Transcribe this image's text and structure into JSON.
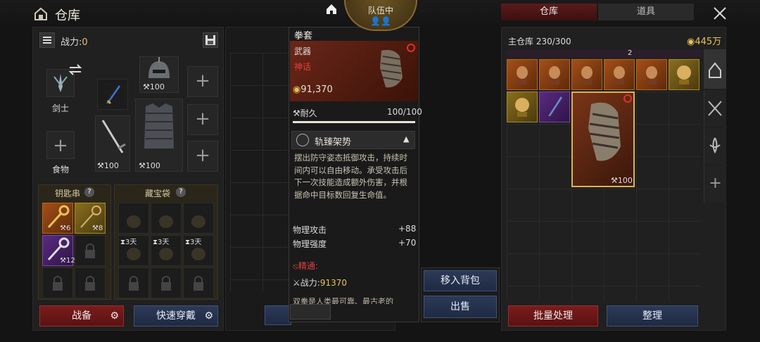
{
  "header": {
    "title": "仓库",
    "home_icon": "home-icon",
    "close_icon": "close-icon"
  },
  "left": {
    "combat_label": "战力:",
    "combat_value": "0",
    "class_label": "剑士",
    "food_label": "食物",
    "helmet_durability": "100",
    "weapon_durability": "100",
    "armor_durability": "100",
    "keyring": {
      "title": "钥匙串",
      "help": "?",
      "counts": [
        "6",
        "8",
        "12"
      ]
    },
    "treasure": {
      "title": "藏宝袋",
      "help": "?",
      "days": [
        "3天",
        "3天",
        "3天"
      ]
    },
    "btn_equip": "战备",
    "btn_quickwear": "快速穿戴"
  },
  "badge": {
    "label": "队伍中"
  },
  "tooltip": {
    "name": "拳套",
    "type": "武器",
    "grade": "神话",
    "price": "91,370",
    "durability_label": "耐久",
    "durability_value": "100/100",
    "durability_pct": 1.0,
    "skill_name": "轨臻架势",
    "skill_desc": "摆出防守姿态抵御攻击，持续时间内可以自由移动。承受攻击后下一次技能造成额外伤害，并根据命中目标数回复生命值。",
    "stats": [
      {
        "label": "物理攻击",
        "value": "+88"
      },
      {
        "label": "物理强度",
        "value": "+70"
      }
    ],
    "refine_label": "精通:",
    "power_label": "战力:",
    "power_value": "91370",
    "lore_text": "双拳是人类最可靠、最古老的"
  },
  "actions": {
    "move_to_bag": "移入背包",
    "sell": "出售"
  },
  "right": {
    "tab_storage": "仓库",
    "tab_items": "道具",
    "storage_label": "主仓库",
    "storage_count": "230/300",
    "gold_amount": "445万",
    "top_partial_count": "2",
    "selected_durability": "100",
    "btn_batch": "批量处理",
    "btn_sort": "整理"
  },
  "colors": {
    "red_button": "#7a1c1c",
    "blue_button": "#2c3a58",
    "gold_text": "#e8c15a",
    "mythic_red": "#e04040",
    "orange_grade": "#a34f17"
  }
}
